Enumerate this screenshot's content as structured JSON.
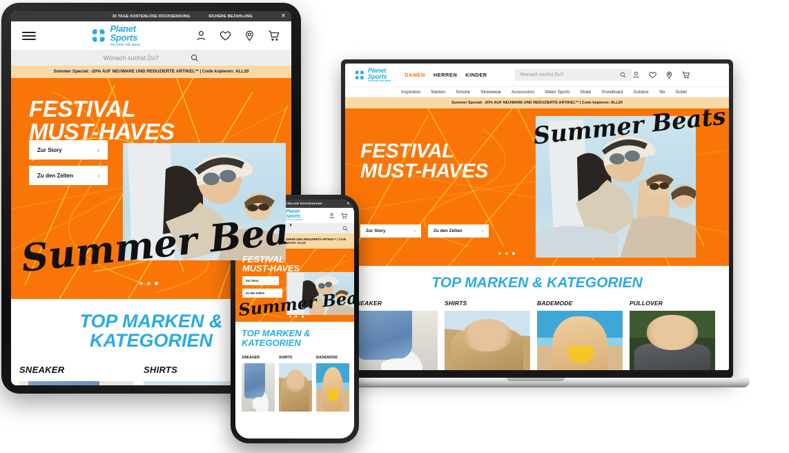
{
  "brand": {
    "name_line1": "Planet",
    "name_line2": "Sports",
    "tagline": "You never ride alone.",
    "accent": "#27AAE1",
    "orange": "#FA7508",
    "promo_bg": "#FBD9A5",
    "topbar_bg": "#3A3A3A"
  },
  "topbar": {
    "left_text": "30 TAGE KOSTENLOSE RÜCKSENDUNG",
    "right_text": "SICHERE BEZAHLUNG",
    "close_icon": "close-icon",
    "close_label": "×"
  },
  "search": {
    "placeholder": "Wonach suchst Du?",
    "icon": "search-icon"
  },
  "promo": {
    "text": "Summer Special: -20% AUF NEUWARE UND REDUZIERTE ARTIKEL** | Code kopieren: ALL20",
    "text_mobile_line1": "Summer Special: -20% AUF NEUWARE UND REDUZIERTE ARTIKEL** | Code",
    "text_mobile_line2": "kopieren: ALL20"
  },
  "header_icons": [
    {
      "name": "account-icon",
      "label": "Konto"
    },
    {
      "name": "wishlist-heart-icon",
      "label": "Merkzettel"
    },
    {
      "name": "store-locator-pin-icon",
      "label": "Filialen"
    },
    {
      "name": "cart-icon",
      "label": "Warenkorb"
    }
  ],
  "gender_nav": [
    {
      "label": "DAMEN",
      "active": true
    },
    {
      "label": "HERREN",
      "active": false
    },
    {
      "label": "KINDER",
      "active": false
    }
  ],
  "main_nav": [
    {
      "label": "Inspiration"
    },
    {
      "label": "Marken"
    },
    {
      "label": "Schuhe"
    },
    {
      "label": "Streetwear"
    },
    {
      "label": "Accessoires"
    },
    {
      "label": "Water Sports"
    },
    {
      "label": "Skate"
    },
    {
      "label": "Snowboard"
    },
    {
      "label": "Outdoor"
    },
    {
      "label": "Ski"
    },
    {
      "label": "Outlet"
    }
  ],
  "hero": {
    "title": "FESTIVAL\nMUST-HAVES",
    "script_text": "Summer Beats",
    "buttons": [
      {
        "label": "Zur Story",
        "chevron": "›"
      },
      {
        "label": "Zu den Zelten",
        "chevron": "›"
      }
    ],
    "carousel_dots": 3,
    "carousel_active_index": 2
  },
  "categories": {
    "title_desktop": "TOP MARKEN & KATEGORIEN",
    "title_wrapped": "TOP MARKEN &\nKATEGORIEN",
    "items": [
      {
        "label": "SNEAKER",
        "photo": "sneaker-photo"
      },
      {
        "label": "SHIRTS",
        "photo": "shirts-photo"
      },
      {
        "label": "BADEMODE",
        "photo": "bademode-photo"
      },
      {
        "label": "PULLOVER",
        "photo": "pullover-photo"
      }
    ]
  },
  "devices": [
    {
      "name": "tablet",
      "label": "Tablet"
    },
    {
      "name": "laptop",
      "label": "Laptop"
    },
    {
      "name": "phone",
      "label": "Smartphone"
    }
  ]
}
